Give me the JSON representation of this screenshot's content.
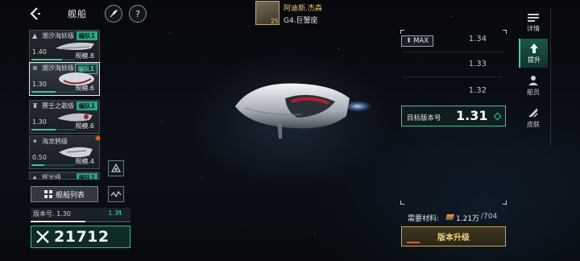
{
  "header": {
    "title": "舰船"
  },
  "commander": {
    "name": "阿迪斯.杰森",
    "title": "G4.巨蟹座",
    "level": "25"
  },
  "ship_cards": [
    {
      "name": "潮汐海妖级",
      "fleet": "编队1",
      "version": "1.40",
      "scale": "规模.8",
      "progress": 0.7
    },
    {
      "name": "潮汐海妖级",
      "fleet": "编队1",
      "version": "1.30",
      "scale": "规模.6",
      "progress": 0.55
    },
    {
      "name": "赛壬之歌级",
      "fleet": "编队1",
      "version": "1.30",
      "scale": "规模.6",
      "progress": 0.55
    },
    {
      "name": "海龙鸦级",
      "fleet": "",
      "version": "0.50",
      "scale": "规模.4",
      "progress": 0.3
    },
    {
      "name": "辉光级",
      "fleet": "编队1",
      "version": "",
      "scale": "",
      "progress": 0
    }
  ],
  "ship_list_button": "舰船列表",
  "version_bar": {
    "label": "版本号. 1.30",
    "arrow": ">",
    "target": "1.31",
    "progress": 0.55
  },
  "power": {
    "value": "21712"
  },
  "panel": {
    "max_label": "MAX",
    "versions": [
      "1.34",
      "1.33",
      "1.32"
    ],
    "target_label": "目标版本号",
    "target_value": "1.31",
    "material_label": "需要材料:",
    "material_have": "1.21万",
    "material_need": "/704",
    "upgrade_label": "版本升级"
  },
  "tabs": [
    {
      "label": "详情",
      "icon": "bars-icon"
    },
    {
      "label": "提升",
      "icon": "upgrade-icon"
    },
    {
      "label": "船员",
      "icon": "crew-icon"
    },
    {
      "label": "皮肤",
      "icon": "skin-icon"
    }
  ],
  "colors": {
    "accent": "#36c89b",
    "gold": "#c9a94e",
    "warn": "#e8601c"
  }
}
